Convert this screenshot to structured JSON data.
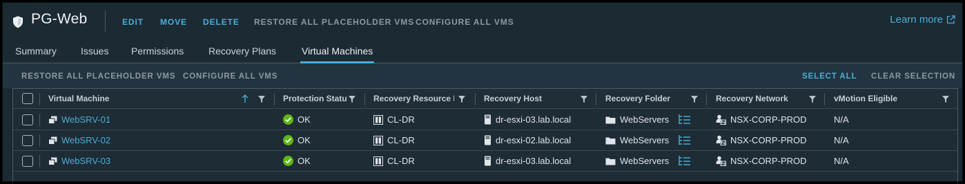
{
  "header": {
    "title": "PG-Web",
    "actions": [
      "EDIT",
      "MOVE",
      "DELETE",
      "RESTORE ALL PLACEHOLDER VMS",
      "CONFIGURE ALL VMS"
    ],
    "learn_more": "Learn more"
  },
  "tabs": [
    "Summary",
    "Issues",
    "Permissions",
    "Recovery Plans",
    "Virtual Machines"
  ],
  "active_tab": "Virtual Machines",
  "toolbar": {
    "restore": "RESTORE ALL PLACEHOLDER VMS",
    "configure": "CONFIGURE ALL VMS",
    "select_all": "SELECT ALL",
    "clear_selection": "CLEAR SELECTION"
  },
  "grid": {
    "columns": [
      "Virtual Machine",
      "Protection Status",
      "Recovery Resource Pool",
      "Recovery Host",
      "Recovery Folder",
      "Recovery Network",
      "vMotion Eligible"
    ],
    "column_labels_visible": [
      "Virtual Machine",
      "Protection Statu",
      "Recovery Resource P’",
      "Recovery Host",
      "Recovery Folder",
      "Recovery Network",
      "vMotion Eligible"
    ],
    "sort": {
      "column": "Virtual Machine",
      "direction": "ascending"
    },
    "rows": [
      {
        "vm": "WebSRV-01",
        "status": "OK",
        "pool": "CL-DR",
        "host": "dr-esxi-03.lab.local",
        "folder": "WebServers",
        "network": "NSX-CORP-PROD",
        "vmotion": "N/A"
      },
      {
        "vm": "WebSRV-02",
        "status": "OK",
        "pool": "CL-DR",
        "host": "dr-esxi-02.lab.local",
        "folder": "WebServers",
        "network": "NSX-CORP-PROD",
        "vmotion": "N/A"
      },
      {
        "vm": "WebSRV-03",
        "status": "OK",
        "pool": "CL-DR",
        "host": "dr-esxi-03.lab.local",
        "folder": "WebServers",
        "network": "NSX-CORP-PROD",
        "vmotion": "N/A"
      }
    ]
  },
  "icons": {
    "title": "shield-icon",
    "external": "external-link-icon",
    "sort": "sort-ascending-icon",
    "filter": "filter-icon",
    "vm": "vm-icon",
    "status_ok": "check-circle-icon",
    "pool": "resource-pool-icon",
    "host": "host-server-icon",
    "folder": "folder-icon",
    "folder_settings": "list-settings-icon",
    "network": "network-icon"
  },
  "colors": {
    "background": "#1c2a33",
    "accent": "#49afd9",
    "ok": "#5eb715",
    "muted_button": "#8d9aa2"
  }
}
